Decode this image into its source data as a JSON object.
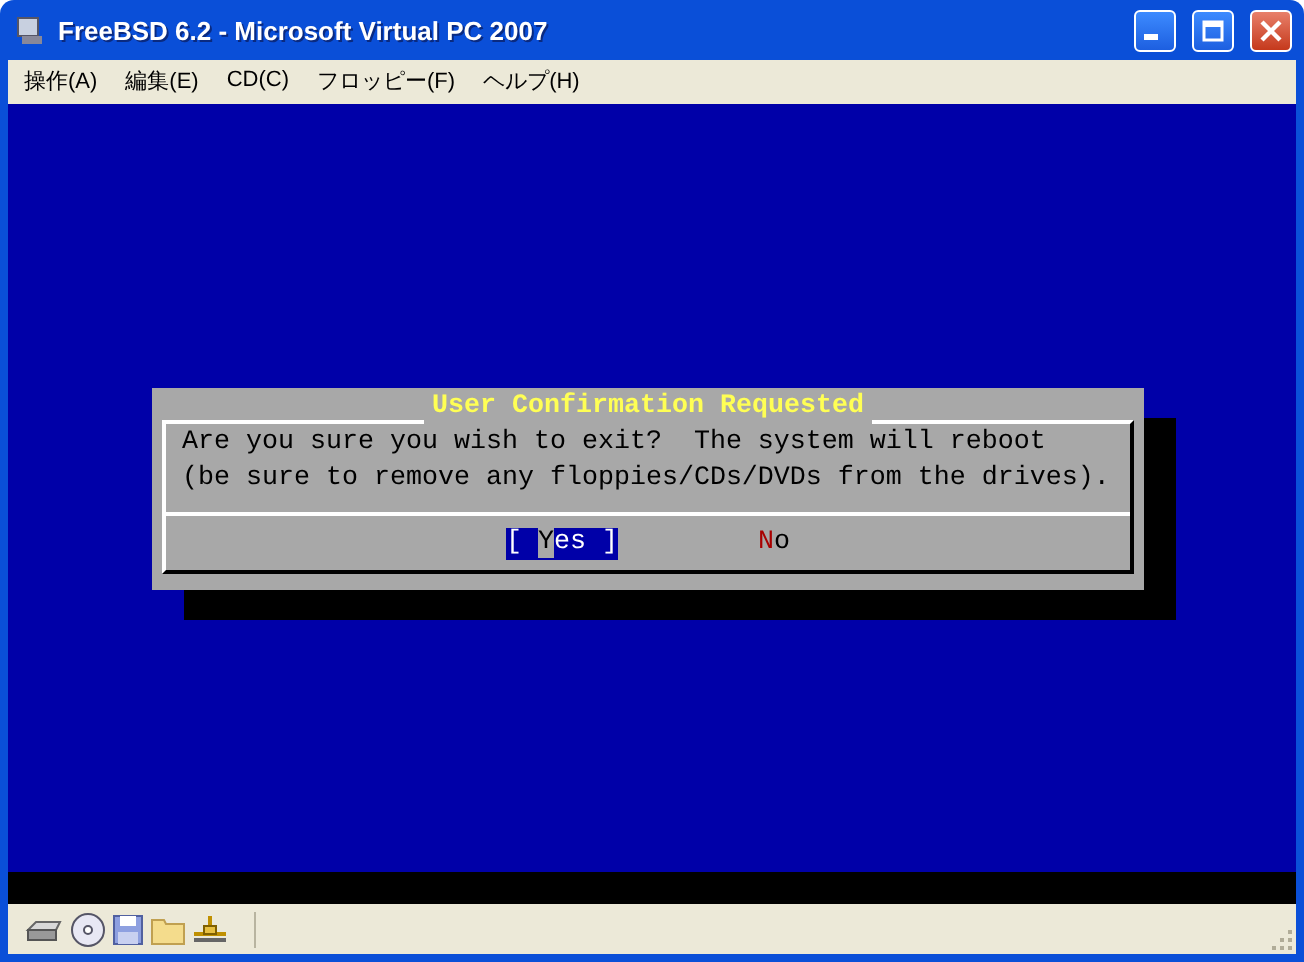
{
  "window": {
    "title": "FreeBSD 6.2 - Microsoft Virtual PC 2007"
  },
  "menu": [
    "操作(A)",
    "編集(E)",
    "CD(C)",
    "フロッピー(F)",
    "ヘルプ(H)"
  ],
  "dialog": {
    "title": "User Confirmation Requested",
    "message": [
      "Are you sure you wish to exit?  The system will reboot",
      "(be sure to remove any floppies/CDs/DVDs from the drives)."
    ],
    "buttons": [
      {
        "prefix": "[ ",
        "hotkey": "Y",
        "rest": "es ]",
        "selected": true
      },
      {
        "hotkey": "N",
        "rest": "o",
        "selected": false
      }
    ]
  }
}
